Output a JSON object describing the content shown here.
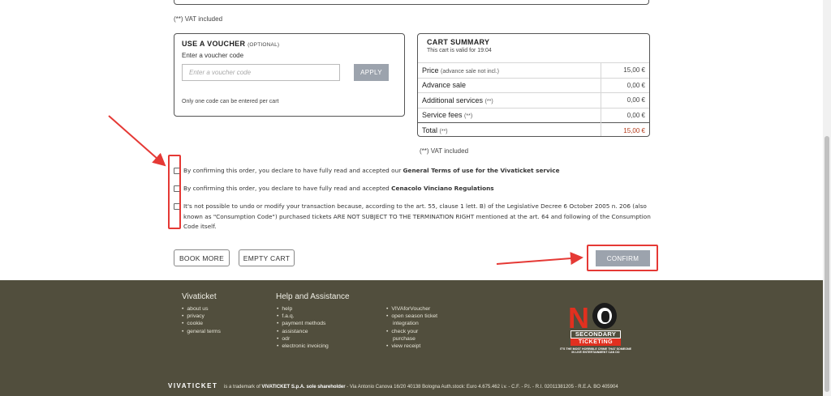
{
  "vat_note_top": "(**) VAT included",
  "voucher": {
    "title": "USE A VOUCHER",
    "optional": "(OPTIONAL)",
    "label": "Enter a voucher code",
    "placeholder": "Enter a voucher code",
    "apply_label": "APPLY",
    "note": "Only one code can be entered per cart"
  },
  "cart_summary": {
    "title": "CART SUMMARY",
    "valid_text": "This cart is valid for",
    "valid_time": "19:04",
    "rows": [
      {
        "label": "Price",
        "sub": "(advance sale not incl.)",
        "amount": "15,00 €"
      },
      {
        "label": "Advance sale",
        "sub": "",
        "amount": "0,00 €"
      },
      {
        "label": "Additional services",
        "sub": "(**)",
        "amount": "0,00 €"
      },
      {
        "label": "Service fees",
        "sub": "(**)",
        "amount": "0,00 €"
      }
    ],
    "total": {
      "label": "Total",
      "sub": "(**)",
      "amount": "15,00 €"
    },
    "vat_note": "(**) VAT included"
  },
  "agreements": [
    {
      "text": "By confirming this order, you declare to have fully read and accepted our ",
      "bold": "General Terms of use for the Vivaticket service"
    },
    {
      "text": "By confirming this order, you declare to have fully read and accepted ",
      "bold": "Cenacolo Vinciano Regulations"
    },
    {
      "text": "It's not possible to undo or modify your transaction because, according to the art. 55, clause 1 lett. B) of the Legislative Decree 6 October 2005 n. 206 (also known as \"Consumption Code\") purchased tickets ARE NOT SUBJECT TO THE TERMINATION RIGHT mentioned at the art. 64 and following of the Consumption Code itself.",
      "bold": ""
    }
  ],
  "actions": {
    "book_more": "BOOK MORE",
    "empty_cart": "EMPTY CART",
    "confirm": "CONFIRM"
  },
  "footer": {
    "col1_title": "Vivaticket",
    "col1_items": [
      "about us",
      "privacy",
      "cookie",
      "general terms"
    ],
    "col2_title": "Help and Assistance",
    "col2_items": [
      "help",
      "f.a.q.",
      "payment methods",
      "assistance",
      "odr",
      "electronic invoicing"
    ],
    "col3_items": [
      "VIVAforVoucher",
      "open season ticket",
      "integration",
      "check your",
      "purchase",
      "view receipt"
    ],
    "brand": "VIVATICKET",
    "trademark_pre": "is a trademark of",
    "company": "VIVATICKET S.p.A. sole shareholder",
    "legal": "- Via Antonio Canova 16/20 40138 Bologna Auth.stock: Euro 4.675.462 i.v. - C.F. - P.I. - R.I. 02011381205 - R.E.A. BO 405904",
    "logo": {
      "letter": "N",
      "line1": "SECONDARY",
      "line2": "TICKETING",
      "motto": "IT'S THE MOST HORRIBLE CRIME THAT SOMEONE IN LIVE ENTERTAINMENT CAN DO"
    }
  },
  "colors": {
    "highlight": "#e53935",
    "footer_bg": "#514e3d",
    "total_amount": "#b33a1a",
    "button_grey": "#9ca3ad"
  }
}
